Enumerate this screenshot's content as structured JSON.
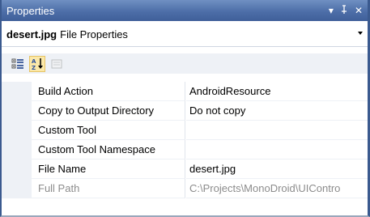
{
  "window": {
    "title": "Properties",
    "controls": [
      "▾",
      "ꟼ",
      "✕"
    ]
  },
  "object_selector": {
    "name": "desert.jpg",
    "type": "File Properties"
  },
  "toolbar": {
    "buttons": [
      {
        "name": "categorized",
        "active": false
      },
      {
        "name": "alphabetical",
        "active": true
      },
      {
        "name": "property-pages",
        "active": false,
        "disabled": true
      }
    ]
  },
  "properties": [
    {
      "name": "Build Action",
      "value": "AndroidResource"
    },
    {
      "name": "Copy to Output Directory",
      "value": "Do not copy"
    },
    {
      "name": "Custom Tool",
      "value": ""
    },
    {
      "name": "Custom Tool Namespace",
      "value": ""
    },
    {
      "name": "File Name",
      "value": "desert.jpg"
    },
    {
      "name": "Full Path",
      "value": "C:\\Projects\\MonoDroid\\UIContro",
      "readonly": true
    }
  ],
  "colors": {
    "titlebar": "#4d6ea8",
    "gutter": "#eef1f6",
    "active_button": "#fbe8a8"
  }
}
